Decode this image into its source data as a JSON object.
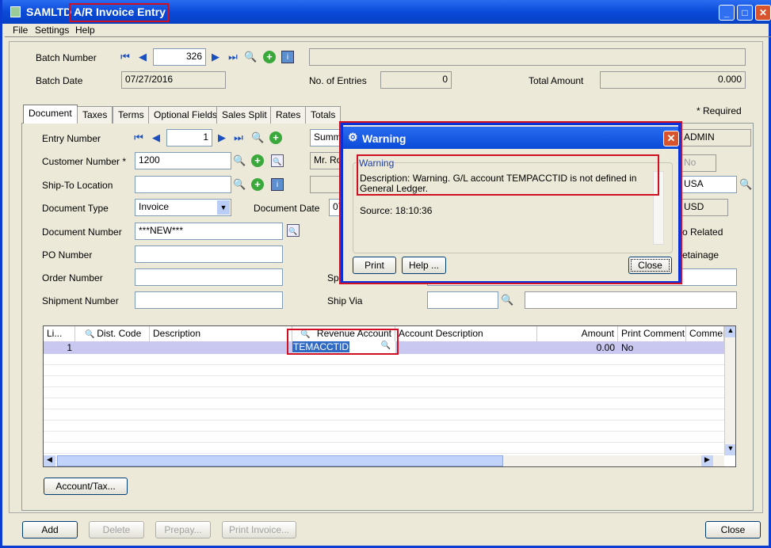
{
  "window": {
    "title_app": "SAMLTD -",
    "title_screen": "A/R Invoice Entry"
  },
  "menu": [
    "File",
    "Settings",
    "Help"
  ],
  "batch": {
    "number_label": "Batch Number",
    "number": "326",
    "date_label": "Batch Date",
    "date": "07/27/2016",
    "entries_label": "No. of Entries",
    "entries": "0",
    "total_label": "Total Amount",
    "total": "0.000"
  },
  "tabs": [
    "Document",
    "Taxes",
    "Terms",
    "Optional Fields",
    "Sales Split",
    "Rates",
    "Totals"
  ],
  "required_note": "*  Required",
  "form": {
    "entry_label": "Entry Number",
    "entry": "1",
    "summary": "Summa",
    "customer_label": "Customer Number *",
    "customer": "1200",
    "customer_name": "Mr. Ron",
    "shipto_label": "Ship-To Location",
    "doctype_label": "Document Type",
    "doctype": "Invoice",
    "docdate_label": "Document Date",
    "docdate": "07",
    "docnum_label": "Document Number",
    "docnum": "***NEW***",
    "po_label": "PO Number",
    "order_label": "Order Number",
    "shipment_label": "Shipment Number",
    "special_label": "Spe",
    "shipvia_label": "Ship Via",
    "admin": "ADMIN",
    "no_field": "No",
    "country": "USA",
    "currency": "USD",
    "job_related": "o Related",
    "retainage": "etainage"
  },
  "grid": {
    "headers": [
      "Li...",
      "Dist. Code",
      "Description",
      "Revenue Account",
      "Account Description",
      "Amount",
      "Print Comment",
      "Commer"
    ],
    "rows": [
      {
        "line": "1",
        "revenue_account": "TEMACCTID",
        "amount": "0.00",
        "print_comment": "No"
      }
    ]
  },
  "account_tax_button": "Account/Tax...",
  "footer": {
    "add": "Add",
    "delete": "Delete",
    "prepay": "Prepay...",
    "print_invoice": "Print Invoice...",
    "close": "Close"
  },
  "dialog": {
    "title": "Warning",
    "group": "Warning",
    "description": "Description: Warning. G/L account TEMPACCTID is not defined in General Ledger.",
    "source": "Source:  18:10:36",
    "print": "Print",
    "help": "Help ...",
    "close": "Close"
  },
  "colors": {
    "highlight": "#d01020",
    "titlebar": "#0a4ad8"
  }
}
